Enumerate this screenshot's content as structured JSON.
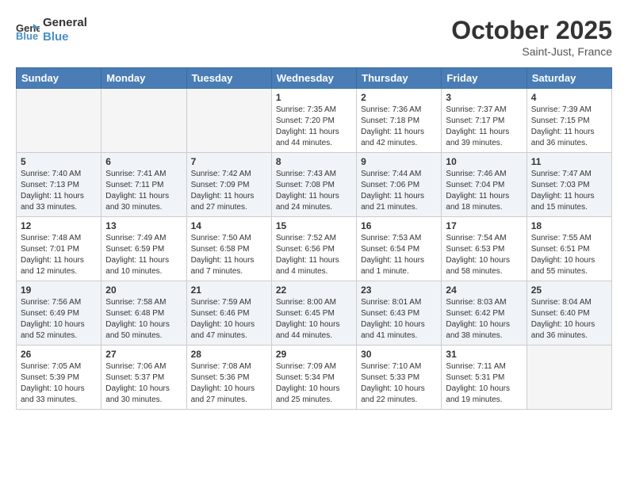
{
  "header": {
    "logo_line1": "General",
    "logo_line2": "Blue",
    "month": "October 2025",
    "location": "Saint-Just, France"
  },
  "weekdays": [
    "Sunday",
    "Monday",
    "Tuesday",
    "Wednesday",
    "Thursday",
    "Friday",
    "Saturday"
  ],
  "weeks": [
    [
      {
        "day": "",
        "info": ""
      },
      {
        "day": "",
        "info": ""
      },
      {
        "day": "",
        "info": ""
      },
      {
        "day": "1",
        "info": "Sunrise: 7:35 AM\nSunset: 7:20 PM\nDaylight: 11 hours\nand 44 minutes."
      },
      {
        "day": "2",
        "info": "Sunrise: 7:36 AM\nSunset: 7:18 PM\nDaylight: 11 hours\nand 42 minutes."
      },
      {
        "day": "3",
        "info": "Sunrise: 7:37 AM\nSunset: 7:17 PM\nDaylight: 11 hours\nand 39 minutes."
      },
      {
        "day": "4",
        "info": "Sunrise: 7:39 AM\nSunset: 7:15 PM\nDaylight: 11 hours\nand 36 minutes."
      }
    ],
    [
      {
        "day": "5",
        "info": "Sunrise: 7:40 AM\nSunset: 7:13 PM\nDaylight: 11 hours\nand 33 minutes."
      },
      {
        "day": "6",
        "info": "Sunrise: 7:41 AM\nSunset: 7:11 PM\nDaylight: 11 hours\nand 30 minutes."
      },
      {
        "day": "7",
        "info": "Sunrise: 7:42 AM\nSunset: 7:09 PM\nDaylight: 11 hours\nand 27 minutes."
      },
      {
        "day": "8",
        "info": "Sunrise: 7:43 AM\nSunset: 7:08 PM\nDaylight: 11 hours\nand 24 minutes."
      },
      {
        "day": "9",
        "info": "Sunrise: 7:44 AM\nSunset: 7:06 PM\nDaylight: 11 hours\nand 21 minutes."
      },
      {
        "day": "10",
        "info": "Sunrise: 7:46 AM\nSunset: 7:04 PM\nDaylight: 11 hours\nand 18 minutes."
      },
      {
        "day": "11",
        "info": "Sunrise: 7:47 AM\nSunset: 7:03 PM\nDaylight: 11 hours\nand 15 minutes."
      }
    ],
    [
      {
        "day": "12",
        "info": "Sunrise: 7:48 AM\nSunset: 7:01 PM\nDaylight: 11 hours\nand 12 minutes."
      },
      {
        "day": "13",
        "info": "Sunrise: 7:49 AM\nSunset: 6:59 PM\nDaylight: 11 hours\nand 10 minutes."
      },
      {
        "day": "14",
        "info": "Sunrise: 7:50 AM\nSunset: 6:58 PM\nDaylight: 11 hours\nand 7 minutes."
      },
      {
        "day": "15",
        "info": "Sunrise: 7:52 AM\nSunset: 6:56 PM\nDaylight: 11 hours\nand 4 minutes."
      },
      {
        "day": "16",
        "info": "Sunrise: 7:53 AM\nSunset: 6:54 PM\nDaylight: 11 hours\nand 1 minute."
      },
      {
        "day": "17",
        "info": "Sunrise: 7:54 AM\nSunset: 6:53 PM\nDaylight: 10 hours\nand 58 minutes."
      },
      {
        "day": "18",
        "info": "Sunrise: 7:55 AM\nSunset: 6:51 PM\nDaylight: 10 hours\nand 55 minutes."
      }
    ],
    [
      {
        "day": "19",
        "info": "Sunrise: 7:56 AM\nSunset: 6:49 PM\nDaylight: 10 hours\nand 52 minutes."
      },
      {
        "day": "20",
        "info": "Sunrise: 7:58 AM\nSunset: 6:48 PM\nDaylight: 10 hours\nand 50 minutes."
      },
      {
        "day": "21",
        "info": "Sunrise: 7:59 AM\nSunset: 6:46 PM\nDaylight: 10 hours\nand 47 minutes."
      },
      {
        "day": "22",
        "info": "Sunrise: 8:00 AM\nSunset: 6:45 PM\nDaylight: 10 hours\nand 44 minutes."
      },
      {
        "day": "23",
        "info": "Sunrise: 8:01 AM\nSunset: 6:43 PM\nDaylight: 10 hours\nand 41 minutes."
      },
      {
        "day": "24",
        "info": "Sunrise: 8:03 AM\nSunset: 6:42 PM\nDaylight: 10 hours\nand 38 minutes."
      },
      {
        "day": "25",
        "info": "Sunrise: 8:04 AM\nSunset: 6:40 PM\nDaylight: 10 hours\nand 36 minutes."
      }
    ],
    [
      {
        "day": "26",
        "info": "Sunrise: 7:05 AM\nSunset: 5:39 PM\nDaylight: 10 hours\nand 33 minutes."
      },
      {
        "day": "27",
        "info": "Sunrise: 7:06 AM\nSunset: 5:37 PM\nDaylight: 10 hours\nand 30 minutes."
      },
      {
        "day": "28",
        "info": "Sunrise: 7:08 AM\nSunset: 5:36 PM\nDaylight: 10 hours\nand 27 minutes."
      },
      {
        "day": "29",
        "info": "Sunrise: 7:09 AM\nSunset: 5:34 PM\nDaylight: 10 hours\nand 25 minutes."
      },
      {
        "day": "30",
        "info": "Sunrise: 7:10 AM\nSunset: 5:33 PM\nDaylight: 10 hours\nand 22 minutes."
      },
      {
        "day": "31",
        "info": "Sunrise: 7:11 AM\nSunset: 5:31 PM\nDaylight: 10 hours\nand 19 minutes."
      },
      {
        "day": "",
        "info": ""
      }
    ]
  ]
}
